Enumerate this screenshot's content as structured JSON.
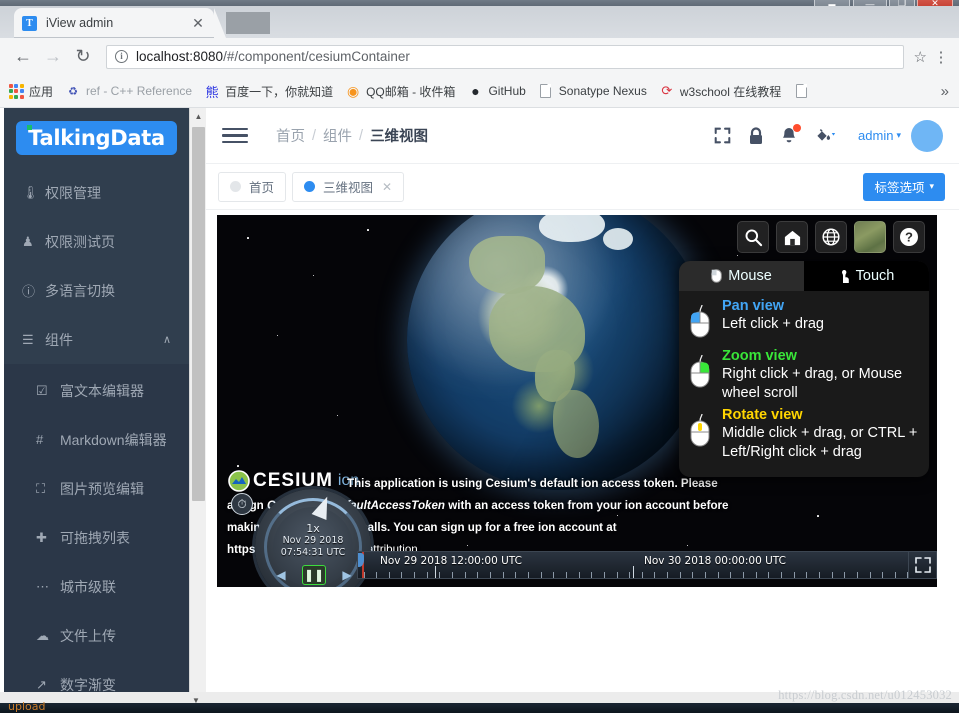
{
  "window": {
    "restore_label": "▃",
    "minimize_label": "—",
    "maximize_label": "❐",
    "close_label": "✕"
  },
  "browser": {
    "tab": {
      "favicon_letter": "T",
      "title": "iView admin",
      "close_label": "✕"
    },
    "nav": {
      "back_label": "←",
      "forward_label": "→",
      "reload_label": "↻",
      "star_label": "☆",
      "menu_label": "⋮"
    },
    "omnibox": {
      "info_label": "i",
      "host": "localhost:8080",
      "path": "/#/component/cesiumContainer",
      "full_url": "localhost:8080/#/component/cesiumContainer"
    },
    "bookmarks": {
      "overflow_label": "»",
      "items": [
        {
          "icon": "apps-grid-icon",
          "label": "应用",
          "glyph": "",
          "faded": false
        },
        {
          "icon": "cpp-reference-icon",
          "label": "ref - C++ Reference",
          "glyph": "♻",
          "faded": true
        },
        {
          "icon": "baidu-icon",
          "label": "百度一下，你就知道",
          "glyph": "熊",
          "faded": false
        },
        {
          "icon": "qqmail-icon",
          "label": "QQ邮箱 - 收件箱",
          "glyph": "◉",
          "faded": false
        },
        {
          "icon": "github-icon",
          "label": "GitHub",
          "glyph": "●",
          "faded": false
        },
        {
          "icon": "document-icon",
          "label": "Sonatype Nexus",
          "glyph": "",
          "faded": false
        },
        {
          "icon": "w3school-icon",
          "label": "w3school 在线教程",
          "glyph": "⟳",
          "faded": false
        },
        {
          "icon": "document-icon",
          "label": "",
          "glyph": "",
          "faded": false
        }
      ]
    }
  },
  "sidebar": {
    "logo": "TalkingData",
    "items": [
      {
        "icon": "thermometer-icon",
        "glyph": "🌡",
        "label": "权限管理"
      },
      {
        "icon": "badge-icon",
        "glyph": "♟",
        "label": "权限测试页"
      },
      {
        "icon": "globe-icon",
        "glyph": "ⓘ",
        "label": "多语言切换"
      }
    ],
    "expanded_group": {
      "icon": "layers-icon",
      "glyph": "☰",
      "label": "组件",
      "arrow": "∧",
      "children": [
        {
          "icon": "edit-icon",
          "glyph": "☑",
          "label": "富文本编辑器"
        },
        {
          "icon": "hash-icon",
          "glyph": "#",
          "label": "Markdown编辑器"
        },
        {
          "icon": "crop-icon",
          "glyph": "⛶",
          "label": "图片预览编辑"
        },
        {
          "icon": "move-icon",
          "glyph": "✚",
          "label": "可拖拽列表"
        },
        {
          "icon": "dots-icon",
          "glyph": "⋯",
          "label": "城市级联"
        },
        {
          "icon": "cloud-upload-icon",
          "glyph": "☁",
          "label": "文件上传"
        },
        {
          "icon": "trend-icon",
          "glyph": "↗",
          "label": "数字渐变"
        }
      ]
    },
    "scroll_up": "▲",
    "scroll_down": "▼"
  },
  "header": {
    "breadcrumb": [
      {
        "label": "首页",
        "active": false
      },
      {
        "label": "组件",
        "active": false
      },
      {
        "label": "三维视图",
        "active": true
      }
    ],
    "separator": "/",
    "icons": [
      {
        "name": "fullscreen-icon",
        "glyph": "⛶"
      },
      {
        "name": "lock-icon",
        "glyph": "🔒"
      },
      {
        "name": "bell-icon",
        "glyph": "🔔"
      },
      {
        "name": "theme-color-icon",
        "glyph": "◢"
      }
    ],
    "user": {
      "name": "admin",
      "caret": "▾"
    }
  },
  "tabbar": {
    "tabs": [
      {
        "label": "首页",
        "active": false,
        "closable": false
      },
      {
        "label": "三维视图",
        "active": true,
        "closable": true,
        "close_label": "✕"
      }
    ],
    "options_button": {
      "label": "标签选项",
      "caret": "▾"
    }
  },
  "cesium": {
    "toolbar": [
      {
        "name": "search-icon",
        "glyph": "🔍"
      },
      {
        "name": "home-icon",
        "glyph": "⌂"
      },
      {
        "name": "scene-mode-globe-icon",
        "glyph": "⊕"
      },
      {
        "name": "base-layer-picker-icon",
        "glyph": ""
      },
      {
        "name": "help-icon",
        "glyph": "?"
      }
    ],
    "nav_help": {
      "tabs": [
        {
          "label": "Mouse",
          "icon": "mouse-icon",
          "glyph": "🖱",
          "selected": true
        },
        {
          "label": "Touch",
          "icon": "hand-icon",
          "glyph": "☝",
          "selected": false
        }
      ],
      "rows": [
        {
          "title": "Pan view",
          "color": "#42a5f5",
          "desc": "Left click + drag",
          "mouse": "left"
        },
        {
          "title": "Zoom view",
          "color": "#39e639",
          "desc": "Right click + drag, or Mouse wheel scroll",
          "mouse": "right"
        },
        {
          "title": "Rotate view",
          "color": "#ffd500",
          "desc": "Middle click + drag, or CTRL + Left/Right click + drag",
          "mouse": "middle"
        }
      ]
    },
    "credits": {
      "logo_text": "CESIUM",
      "logo_sub": "ion",
      "line1": "This application is using Cesium's default ion access token. Please",
      "line2_a": "assign",
      "line2_em": "Cesium.Ion.defaultAccessToken",
      "line2_b": "with an access token from your ion account before",
      "line3": "making any Cesium API calls. You can sign up for a free ion account at",
      "line4": "https://cesium.com.",
      "link": "Data attribution"
    },
    "animation": {
      "clock_icon": "⏱",
      "rate": "1x",
      "date": "Nov 29 2018",
      "time": "07:54:31 UTC",
      "buttons": [
        {
          "name": "reverse-button",
          "glyph": "◀"
        },
        {
          "name": "pause-button",
          "glyph": "❚❚"
        },
        {
          "name": "play-button",
          "glyph": "▶"
        }
      ]
    },
    "timeline": {
      "labels": [
        {
          "text": "Nov 29 2018 12:00:00 UTC",
          "pct": 4
        },
        {
          "text": "Nov 30 2018 00:00:00 UTC",
          "pct": 52
        }
      ],
      "majors_pct": [
        14,
        50
      ],
      "resize_icon": "⤡⤢"
    }
  },
  "footer": {
    "watermark": "https://blog.csdn.net/u012453032",
    "taskbar_text": "upload"
  }
}
